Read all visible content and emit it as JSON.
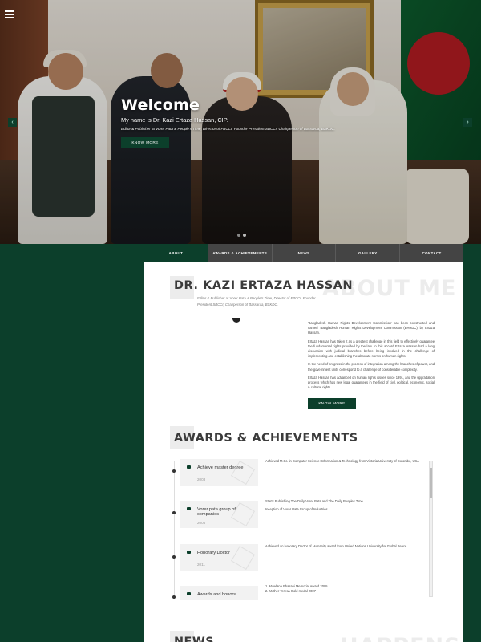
{
  "hero": {
    "title": "Welcome",
    "subtitle": "My name is Dr. Kazi Ertaza Hassan, CIP.",
    "description": "Editor & Publisher at Vorer Pata & People's Time, Director of FBCCI, Founder President SBCCI, Chairperson of Bassarua, BSKDC.",
    "button_label": "KNOW MORE",
    "prev_arrow": "‹",
    "next_arrow": "›"
  },
  "nav": {
    "items": [
      "ABOUT",
      "AWARDS & ACHIEVEMENTS",
      "NEWS",
      "GALLERY",
      "CONTACT"
    ],
    "active": "ABOUT"
  },
  "about": {
    "bg_heading": "ABOUT ME",
    "name": "DR. KAZI ERTAZA HASSAN",
    "roles": "Editor & Publisher at Vorer Pata & People's Time, Director of FBCCI, Founder President SBCCI, Chairperson of Bassarua, BSKDC.",
    "paragraphs": [
      "'Bangladesh Human Rights Development Commission' has been constructed and named 'Bangladesh Human Rights Development Commission (BHRDC)' by Ertaza Hassan.",
      "Ertaza Hassan has taken it as a greatest challenge in this field to effectively guarantee the fundamental rights provided by the law. In this accord Ertaza Hassan had a long discussion with judicial branches before being involved in the challenge of implementing and establishing the absolute norms on human rights.",
      "In the need of progress in the process of integration among the branches of power, and the government units correspond to a challenge of considerable complexity.",
      "Ertaza Hassan has advanced on human rights issues since 1991, and the upgradation process which has new legal guarantees in the field of civil, political, economic, social & cultural rights."
    ],
    "button_label": "KNOW MORE"
  },
  "awards": {
    "heading": "AWARDS & ACHIEVEMENTS",
    "items": [
      {
        "title": "Achieve master degree",
        "year": "2003",
        "details": [
          "Achieved M.Sc. in Computer Science: Information & Technology from Victoria University of Colombo, USA"
        ]
      },
      {
        "title": "Vorer pata group of companies",
        "year": "2005",
        "details": [
          "Starts Publishing The Daily Vorer Pata and The Daily Peoples Time.",
          "Inception of Vorer Pata Group of Industries"
        ]
      },
      {
        "title": "Honorary Doctor",
        "year": "2011",
        "details": [
          "Achieved an honorary Doctor of Humanity award from United Nations University for Global Peace."
        ]
      },
      {
        "title": "Awards and honors",
        "year": "",
        "details": [
          "1.    Mowlana Bhasani Memorial Award 2005",
          "2.    Mother Teresa Gold medal 2007"
        ]
      }
    ]
  },
  "news": {
    "heading": "NEWS",
    "bg_heading": "HAPPENS"
  },
  "colors": {
    "primary": "#0c3f2b",
    "nav_bg": "#444444",
    "text": "#3b3b3b"
  }
}
